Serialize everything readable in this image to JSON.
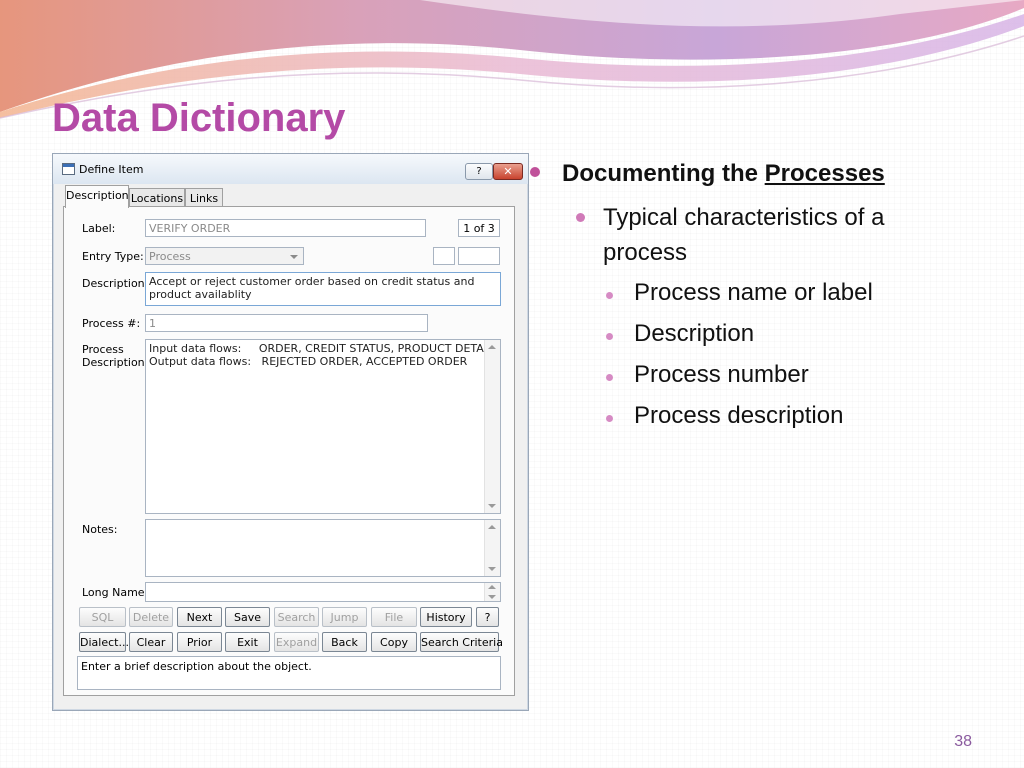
{
  "slide": {
    "title": "Data Dictionary",
    "page_number": "38",
    "colors": {
      "title": "#b44aa6",
      "accent": "#c0519a"
    }
  },
  "bullets": {
    "level1": {
      "prefix": "Documenting the ",
      "underlined": "Processes"
    },
    "level2": "Typical characteristics of a process",
    "level3": [
      "Process name or label",
      "Description",
      "Process number",
      "Process description"
    ]
  },
  "dialog": {
    "title": "Define Item",
    "help_icon": "?",
    "close_icon": "✕",
    "tabs": [
      "Description",
      "Locations",
      "Links"
    ],
    "active_tab": "Description",
    "label_caption": "Label:",
    "label_value": "VERIFY ORDER",
    "counter": "1 of 3",
    "entry_type_caption": "Entry Type:",
    "entry_type_value": "Process",
    "description_caption": "Description:",
    "description_value": "Accept or reject customer order based on credit status and product availablity",
    "process_num_caption": "Process #:",
    "process_num_value": "1",
    "process_desc_caption_1": "Process",
    "process_desc_caption_2": "Description:",
    "process_desc_lines": [
      "Input data flows:     ORDER, CREDIT STATUS, PRODUCT DETAIL",
      "Output data flows:   REJECTED ORDER, ACCEPTED ORDER"
    ],
    "notes_caption": "Notes:",
    "long_name_caption": "Long Name:",
    "buttons_row1": [
      "SQL",
      "Delete",
      "Next",
      "Save",
      "Search",
      "Jump",
      "File",
      "History",
      "?"
    ],
    "buttons_row2": [
      "Dialect...",
      "Clear",
      "Prior",
      "Exit",
      "Expand",
      "Back",
      "Copy",
      "Search Criteria"
    ],
    "status_text": "Enter a brief description about the object."
  }
}
